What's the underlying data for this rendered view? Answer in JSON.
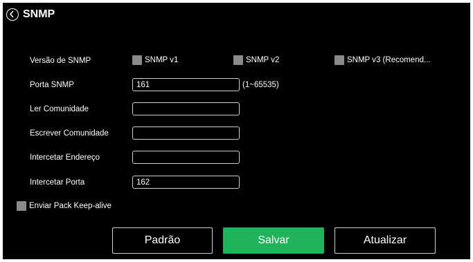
{
  "header": {
    "title": "SNMP",
    "back_icon": "chevron-left-circle-icon"
  },
  "snmp_version": {
    "label": "Versão de SNMP",
    "options": [
      {
        "label": "SNMP v1",
        "checked": false
      },
      {
        "label": "SNMP v2",
        "checked": false
      },
      {
        "label": "SNMP v3 (Recomend...",
        "checked": false
      }
    ]
  },
  "fields": {
    "port": {
      "label": "Porta SNMP",
      "value": "161",
      "hint": "(1~65535)"
    },
    "read_community": {
      "label": "Ler Comunidade",
      "value": ""
    },
    "write_community": {
      "label": "Escrever Comunidade",
      "value": ""
    },
    "trap_address": {
      "label": "Intercetar Endereço",
      "value": ""
    },
    "trap_port": {
      "label": "Intercetar Porta",
      "value": "162"
    }
  },
  "keepalive": {
    "label": "Enviar Pack Keep-alive",
    "checked": false
  },
  "buttons": {
    "default": "Padrão",
    "save": "Salvar",
    "refresh": "Atualizar"
  },
  "colors": {
    "background": "#000000",
    "text": "#ffffff",
    "checkbox": "#8a8a8a",
    "input_border": "#cfcfcf",
    "primary": "#1fb35a"
  }
}
